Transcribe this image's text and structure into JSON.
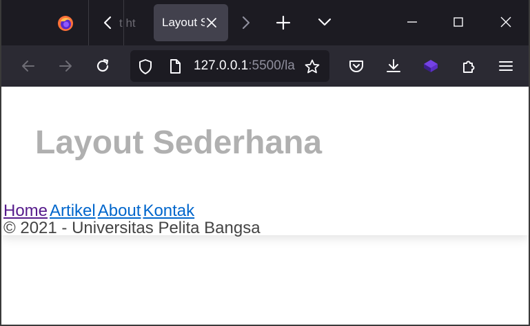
{
  "browser": {
    "prev_tab_fragment": "t ht",
    "active_tab_title": "Layout S",
    "url_host": "127.0.0.1",
    "url_rest": ":5500/la"
  },
  "page": {
    "title": "Layout Sederhana",
    "nav": [
      {
        "label": "Home",
        "visited": true
      },
      {
        "label": "Artikel",
        "visited": false
      },
      {
        "label": "About",
        "visited": false
      },
      {
        "label": "Kontak",
        "visited": false
      }
    ],
    "footer": "© 2021 - Universitas Pelita Bangsa"
  },
  "colors": {
    "tabstrip_bg": "#1c1b22",
    "toolbar_bg": "#2b2a33",
    "title_gray": "#b0b0b0",
    "link_blue": "#0066cc",
    "link_visited": "#551a8b"
  }
}
